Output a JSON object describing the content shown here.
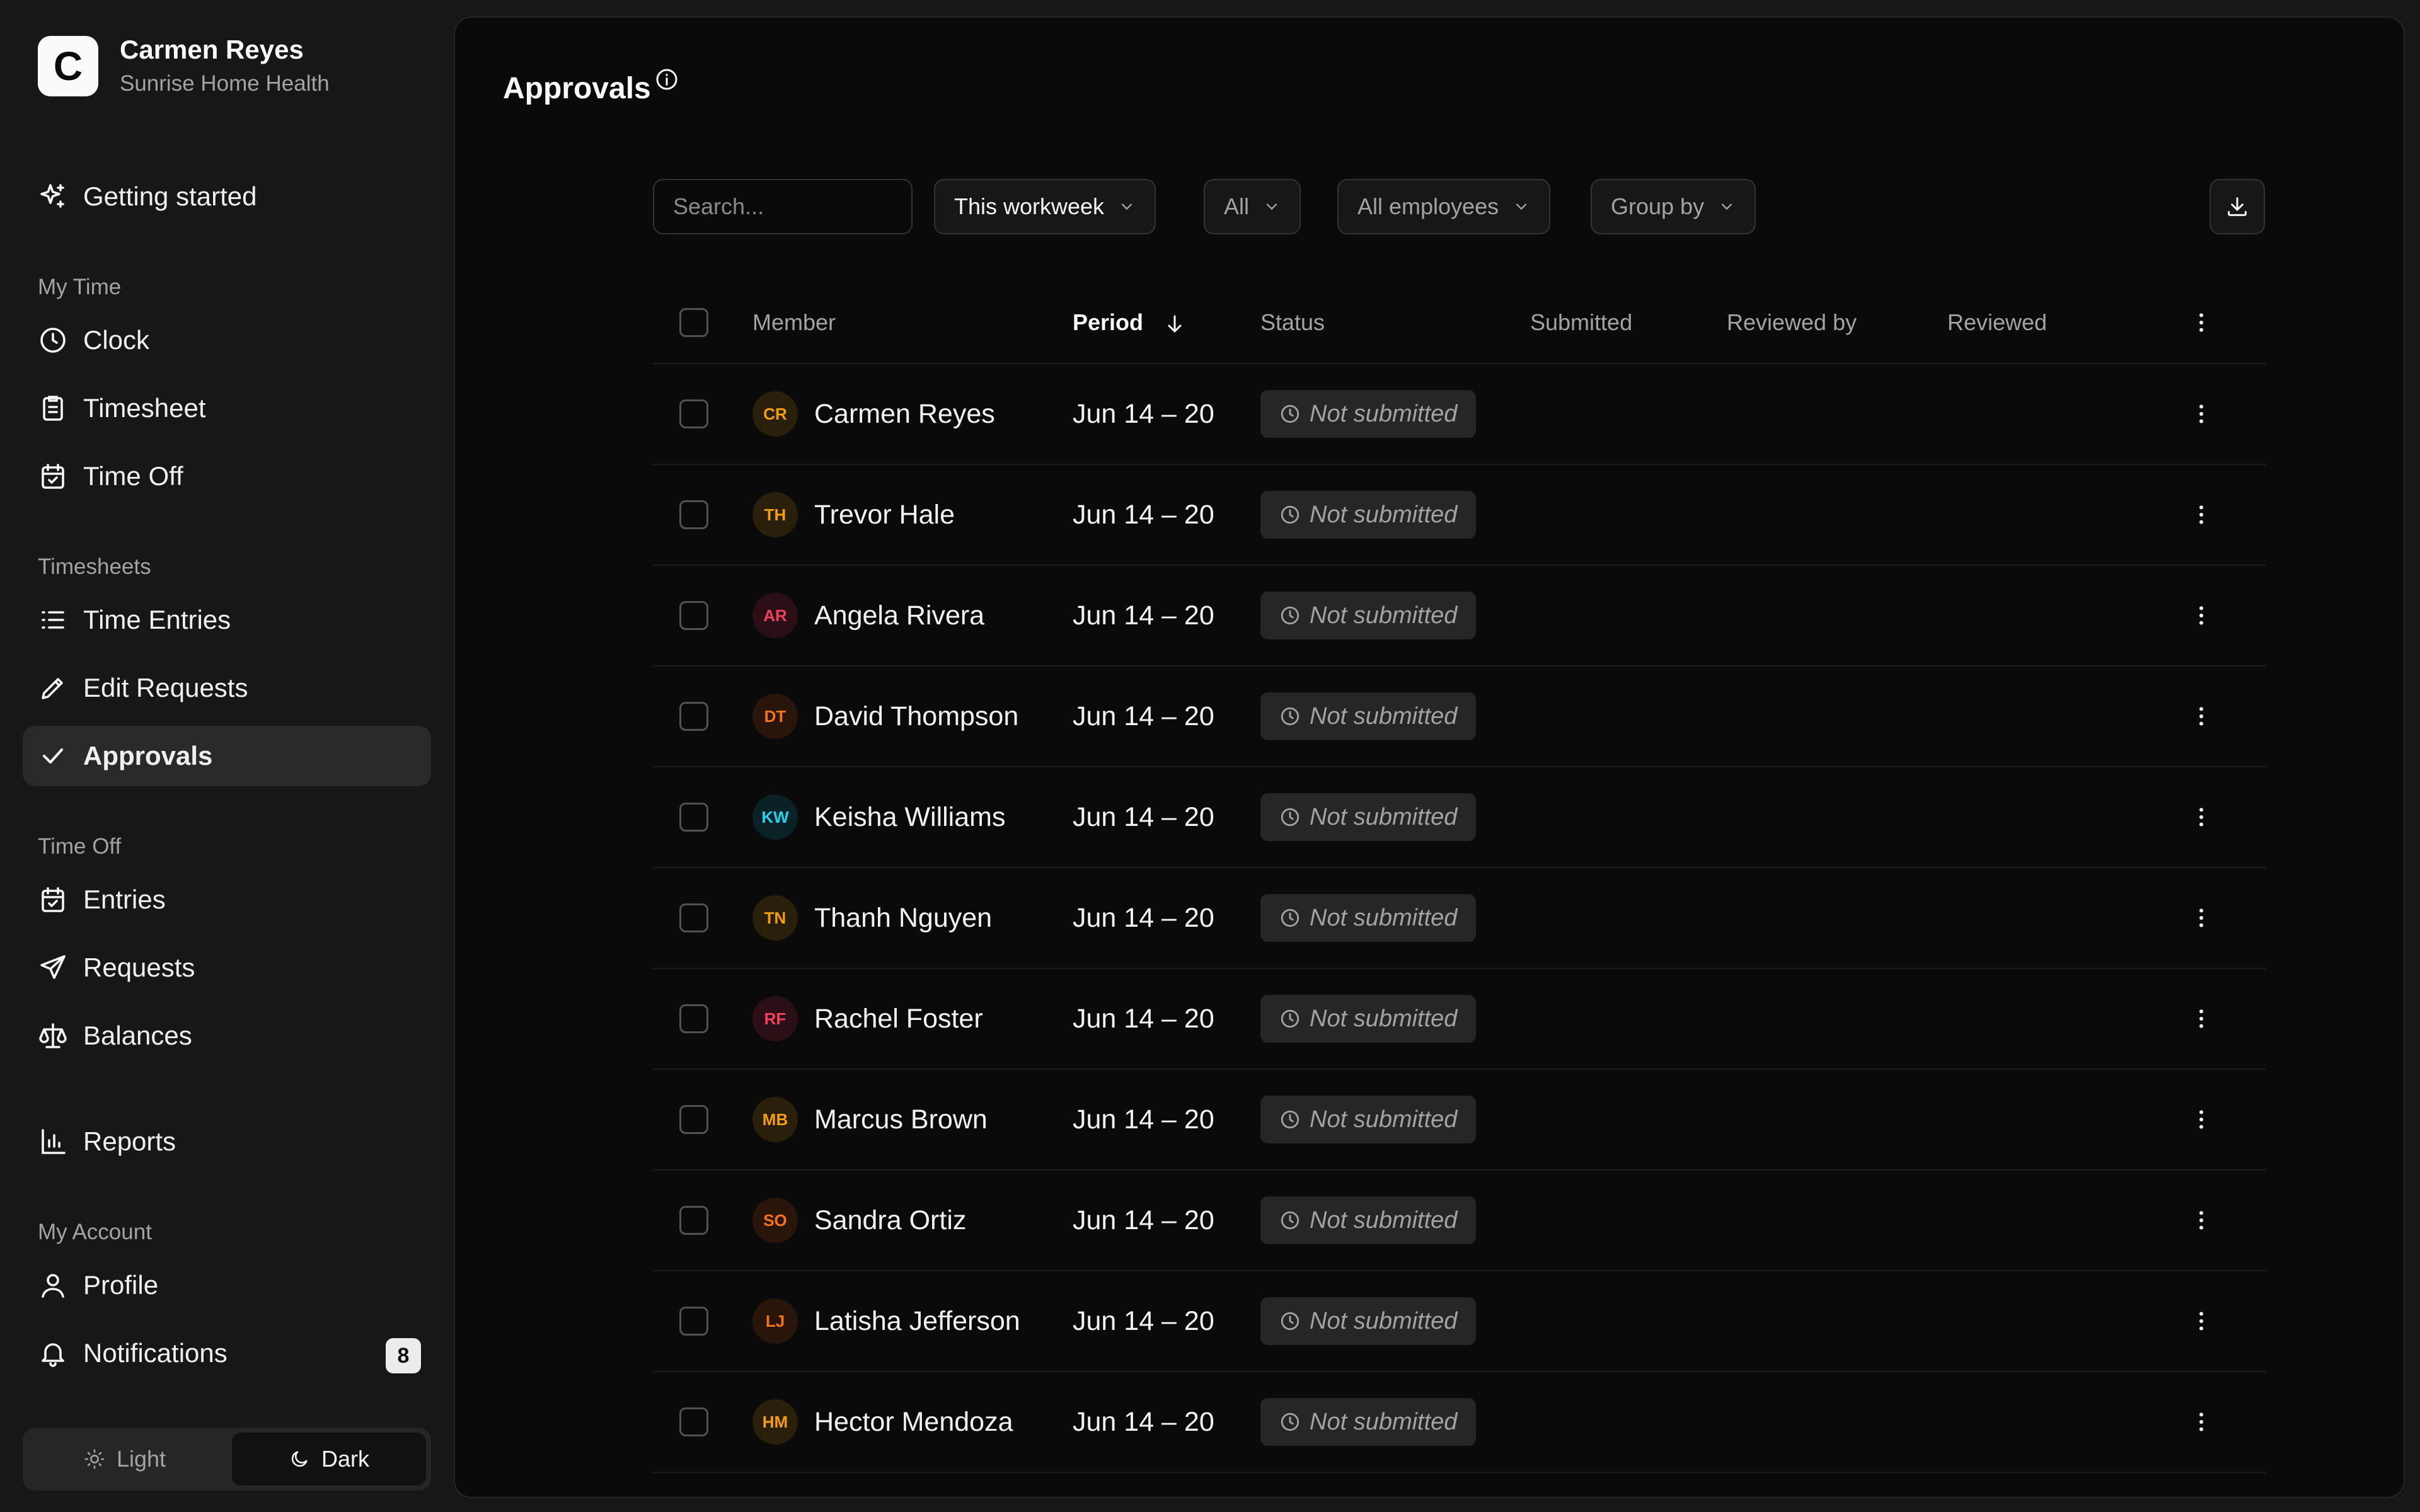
{
  "user": {
    "name": "Carmen Reyes",
    "org": "Sunrise Home Health",
    "logo_letter": "C"
  },
  "nav": {
    "getting_started": "Getting started",
    "sections": {
      "my_time": "My Time",
      "timesheets": "Timesheets",
      "time_off": "Time Off",
      "my_account": "My Account"
    },
    "items": {
      "clock": "Clock",
      "timesheet": "Timesheet",
      "time_off": "Time Off",
      "time_entries": "Time Entries",
      "edit_requests": "Edit Requests",
      "approvals": "Approvals",
      "entries": "Entries",
      "requests": "Requests",
      "balances": "Balances",
      "reports": "Reports",
      "profile": "Profile",
      "notifications": "Notifications"
    },
    "notifications_count": "8"
  },
  "theme": {
    "light": "Light",
    "dark": "Dark",
    "selected": "Dark"
  },
  "page": {
    "title": "Approvals"
  },
  "toolbar": {
    "search_placeholder": "Search...",
    "period_filter": "This workweek",
    "status_filter": "All",
    "employee_filter": "All employees",
    "group_by": "Group by"
  },
  "table": {
    "columns": {
      "member": "Member",
      "period": "Period",
      "status": "Status",
      "submitted": "Submitted",
      "reviewed_by": "Reviewed by",
      "reviewed": "Reviewed"
    },
    "rows": [
      {
        "initials": "CR",
        "name": "Carmen Reyes",
        "period": "Jun 14 – 20",
        "status": "Not submitted",
        "color": "#f59e0b",
        "bg": "#2a1f0a"
      },
      {
        "initials": "TH",
        "name": "Trevor Hale",
        "period": "Jun 14 – 20",
        "status": "Not submitted",
        "color": "#f59e0b",
        "bg": "#2a1f0a"
      },
      {
        "initials": "AR",
        "name": "Angela Rivera",
        "period": "Jun 14 – 20",
        "status": "Not submitted",
        "color": "#f43f5e",
        "bg": "#2a0f16"
      },
      {
        "initials": "DT",
        "name": "David Thompson",
        "period": "Jun 14 – 20",
        "status": "Not submitted",
        "color": "#f97316",
        "bg": "#2a150a"
      },
      {
        "initials": "KW",
        "name": "Keisha Williams",
        "period": "Jun 14 – 20",
        "status": "Not submitted",
        "color": "#22d3ee",
        "bg": "#0a2126"
      },
      {
        "initials": "TN",
        "name": "Thanh Nguyen",
        "period": "Jun 14 – 20",
        "status": "Not submitted",
        "color": "#f59e0b",
        "bg": "#2a1f0a"
      },
      {
        "initials": "RF",
        "name": "Rachel Foster",
        "period": "Jun 14 – 20",
        "status": "Not submitted",
        "color": "#f43f5e",
        "bg": "#2a0f16"
      },
      {
        "initials": "MB",
        "name": "Marcus Brown",
        "period": "Jun 14 – 20",
        "status": "Not submitted",
        "color": "#f59e0b",
        "bg": "#2a1f0a"
      },
      {
        "initials": "SO",
        "name": "Sandra Ortiz",
        "period": "Jun 14 – 20",
        "status": "Not submitted",
        "color": "#f97316",
        "bg": "#2a150a"
      },
      {
        "initials": "LJ",
        "name": "Latisha Jefferson",
        "period": "Jun 14 – 20",
        "status": "Not submitted",
        "color": "#f97316",
        "bg": "#2a150a"
      },
      {
        "initials": "HM",
        "name": "Hector Mendoza",
        "period": "Jun 14 – 20",
        "status": "Not submitted",
        "color": "#f59e0b",
        "bg": "#2a1f0a"
      }
    ]
  }
}
